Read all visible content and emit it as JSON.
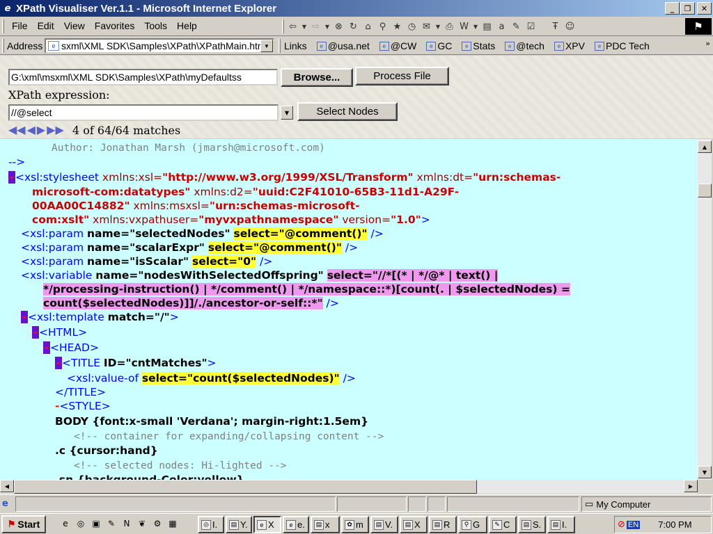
{
  "window": {
    "title": "XPath Visualiser Ver.1.1 - Microsoft Internet Explorer",
    "app_icon": "ie-icon",
    "min": "_",
    "max": "❐",
    "close": "✕"
  },
  "menu": [
    "File",
    "Edit",
    "View",
    "Favorites",
    "Tools",
    "Help"
  ],
  "toolbar_icons": [
    "back-icon",
    "forward-icon",
    "stop-icon",
    "refresh-icon",
    "home-icon",
    "search-icon",
    "favorites-icon",
    "history-icon",
    "mail-icon",
    "print-icon",
    "edit-icon",
    "discuss-icon",
    "messenger-icon"
  ],
  "address": {
    "label": "Address",
    "value": "sxml\\XML SDK\\Samples\\XPath\\XPathMain.htm"
  },
  "links": {
    "label": "Links",
    "items": [
      "@usa.net",
      "@CW",
      "GC",
      "Stats",
      "@tech",
      "XPV",
      "PDC Tech"
    ]
  },
  "form": {
    "file_value": "G:\\xml\\msxml\\XML SDK\\Samples\\XPath\\myDefaultss",
    "browse_label": "Browse...",
    "process_label": "Process File",
    "xpath_label": "XPath expression:",
    "xpath_value": "//@select",
    "select_label": "Select Nodes",
    "matches": "4 of 64/64 matches"
  },
  "code": {
    "l1": "Author:  Jonathan Marsh (jmarsh@microsoft.com)",
    "l2": "-->",
    "stylesheet_open": "<xsl:stylesheet",
    "a_xmlns_xsl": "xmlns:xsl=",
    "v_xmlns_xsl": "\"http://www.w3.org/1999/XSL/Transform\"",
    "a_xmlns_dt": "xmlns:dt=",
    "v_xmlns_dt_1": "\"urn:schemas-",
    "v_xmlns_dt_2": "microsoft-com:datatypes\"",
    "a_xmlns_d2": "xmlns:d2=",
    "v_xmlns_d2_1": "\"uuid:C2F41010-65B3-11d1-A29F-",
    "v_xmlns_d2_2": "00AA00C14882\"",
    "a_xmlns_msxsl": "xmlns:msxsl=",
    "v_xmlns_msxsl_1": "\"urn:schemas-microsoft-",
    "v_xmlns_msxsl_2": "com:xslt\"",
    "a_xmlns_vx": "xmlns:vxpathuser=",
    "v_xmlns_vx": "\"myvxpathnamespace\"",
    "a_version": "version=",
    "v_version": "\"1.0\"",
    "param1": "<xsl:param",
    "param1_name": "name=\"selectedNodes\"",
    "param1_sel": "select=\"@comment()\"",
    "param2_name": "name=\"scalarExpr\"",
    "param2_sel": "select=\"@comment()\"",
    "param3_name": "name=\"isScalar\"",
    "param3_sel": "select=\"0\"",
    "variable": "<xsl:variable",
    "var_name": "name=\"nodesWithSelectedOffspring\"",
    "var_sel_1": "select=\"//*[(* | */@* | text() |",
    "var_sel_2": "*/processing-instruction() | */comment() | */namespace::*)[count(. | $selectedNodes) =",
    "var_sel_3": "count($selectedNodes)]]/./ancestor-or-self::*\"",
    "selfclose": "/>",
    "gt": ">",
    "template": "<xsl:template",
    "template_match": "match=\"/\"",
    "html": "<HTML>",
    "head": "<HEAD>",
    "title_open": "<TITLE",
    "title_id": "ID=\"cntMatches\"",
    "valueof": "<xsl:value-of",
    "valueof_sel": "select=\"count($selectedNodes)\"",
    "title_close": "</TITLE>",
    "style": "<STYLE>",
    "css1": "BODY {font:x-small 'Verdana'; margin-right:1.5em}",
    "cmt1": "<!-- container for expanding/collapsing content -->",
    "css2": ".c {cursor:hand}",
    "cmt2": "<!-- selected nodes: Hi-lighted -->",
    "css3": ".sn {background-Color:yellow}",
    "minus": "-"
  },
  "status": {
    "zone": "My Computer"
  },
  "taskbar": {
    "start": "Start",
    "tasks": [
      "I.",
      "Y.",
      "X",
      "e.",
      "x",
      "m",
      "V.",
      "X",
      "R",
      "G",
      "C",
      "S.",
      "I."
    ],
    "lang": "EN",
    "time": "7:00 PM"
  }
}
